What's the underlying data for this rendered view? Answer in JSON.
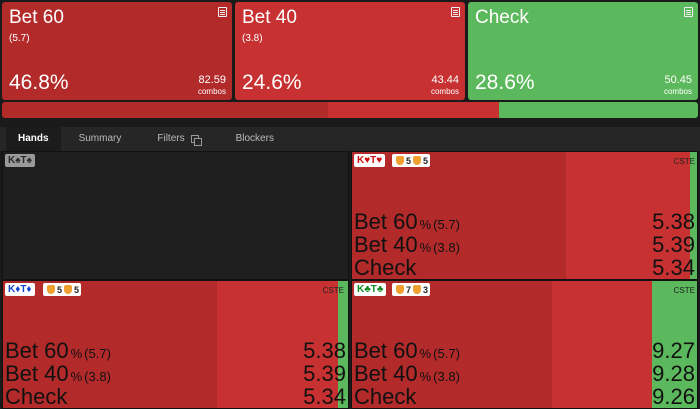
{
  "actions": [
    {
      "name": "Bet 60",
      "size": "(5.7)",
      "pct": "46.8%",
      "combos": "82.59",
      "combos_label": "combos",
      "color": "#b22a2a"
    },
    {
      "name": "Bet 40",
      "size": "(3.8)",
      "pct": "24.6%",
      "combos": "43.44",
      "combos_label": "combos",
      "color": "#c83131"
    },
    {
      "name": "Check",
      "size": "",
      "pct": "28.6%",
      "combos": "50.45",
      "combos_label": "combos",
      "color": "#5cb85c"
    }
  ],
  "frequency_bar": [
    {
      "action": "Bet 60",
      "fraction": 0.468,
      "color": "#b22a2a"
    },
    {
      "action": "Bet 40",
      "fraction": 0.246,
      "color": "#c83131"
    },
    {
      "action": "Check",
      "fraction": 0.286,
      "color": "#5cb85c"
    }
  ],
  "tabs": {
    "hands": "Hands",
    "summary": "Summary",
    "filters": "Filters",
    "blockers": "Blockers",
    "active": "Hands"
  },
  "hands": [
    {
      "label": "K♠T♠",
      "suit_color": "#2a2a2a",
      "empty": true
    },
    {
      "label": "K♥T♥",
      "suit_color": "#cc1111",
      "badge_a": "5",
      "badge_b": "5",
      "tag": "CSTE",
      "rows": [
        {
          "name": "Bet 60",
          "unit": "%",
          "size": "(5.7)",
          "ev": "5.38"
        },
        {
          "name": "Bet 40",
          "unit": "%",
          "size": "(3.8)",
          "ev": "5.39"
        },
        {
          "name": "Check",
          "unit": "",
          "size": "",
          "ev": "5.34"
        }
      ],
      "freq": [
        0.62,
        0.36,
        0.02
      ]
    },
    {
      "label": "K♦T♦",
      "suit_color": "#1144cc",
      "badge_a": "5",
      "badge_b": "5",
      "tag": "CSTE",
      "rows": [
        {
          "name": "Bet 60",
          "unit": "%",
          "size": "(5.7)",
          "ev": "5.38"
        },
        {
          "name": "Bet 40",
          "unit": "%",
          "size": "(3.8)",
          "ev": "5.39"
        },
        {
          "name": "Check",
          "unit": "",
          "size": "",
          "ev": "5.34"
        }
      ],
      "freq": [
        0.62,
        0.35,
        0.03
      ]
    },
    {
      "label": "K♣T♣",
      "suit_color": "#118822",
      "badge_a": "7",
      "badge_b": "3",
      "tag": "CSTE",
      "rows": [
        {
          "name": "Bet 60",
          "unit": "%",
          "size": "(5.7)",
          "ev": "9.27"
        },
        {
          "name": "Bet 40",
          "unit": "%",
          "size": "(3.8)",
          "ev": "9.28"
        },
        {
          "name": "Check",
          "unit": "",
          "size": "",
          "ev": "9.26"
        }
      ],
      "freq": [
        0.58,
        0.29,
        0.13
      ]
    }
  ]
}
